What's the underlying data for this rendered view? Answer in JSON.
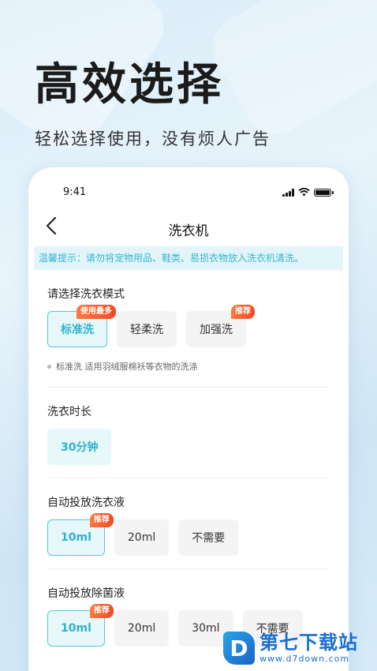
{
  "hero": {
    "title": "高效选择",
    "subtitle": "轻松选择使用，没有烦人广告"
  },
  "status_bar": {
    "time": "9:41"
  },
  "nav": {
    "back_icon": "chevron-left-icon",
    "title": "洗衣机"
  },
  "notice": "温馨提示：请勿将宠物用品、鞋类、易损衣物放入洗衣机清洗。",
  "mode": {
    "title": "请选择洗衣模式",
    "options": [
      {
        "label": "标准洗",
        "badge": "使用最多",
        "selected": true
      },
      {
        "label": "轻柔洗",
        "badge": "",
        "selected": false
      },
      {
        "label": "加强洗",
        "badge": "推荐",
        "selected": false
      }
    ],
    "hint": "标准洗 适用羽绒服棉袄等衣物的洗涤"
  },
  "duration": {
    "title": "洗衣时长",
    "value": "30分钟"
  },
  "detergent": {
    "title": "自动投放洗衣液",
    "options": [
      {
        "label": "10ml",
        "badge": "推荐",
        "selected": true
      },
      {
        "label": "20ml",
        "badge": "",
        "selected": false
      },
      {
        "label": "不需要",
        "badge": "",
        "selected": false
      }
    ]
  },
  "disinfectant": {
    "title": "自动投放除菌液",
    "options": [
      {
        "label": "10ml",
        "badge": "推荐",
        "selected": true
      },
      {
        "label": "20ml",
        "badge": "",
        "selected": false
      },
      {
        "label": "30ml",
        "badge": "",
        "selected": false
      },
      {
        "label": "不需要",
        "badge": "",
        "selected": false
      }
    ]
  },
  "watermark": {
    "logo": "D",
    "name": "第七下载站",
    "url": "www.d7down.com"
  },
  "colors": {
    "accent": "#2fb2cc",
    "badge": "#f04a2a",
    "notice_bg": "#e2f5fa"
  }
}
